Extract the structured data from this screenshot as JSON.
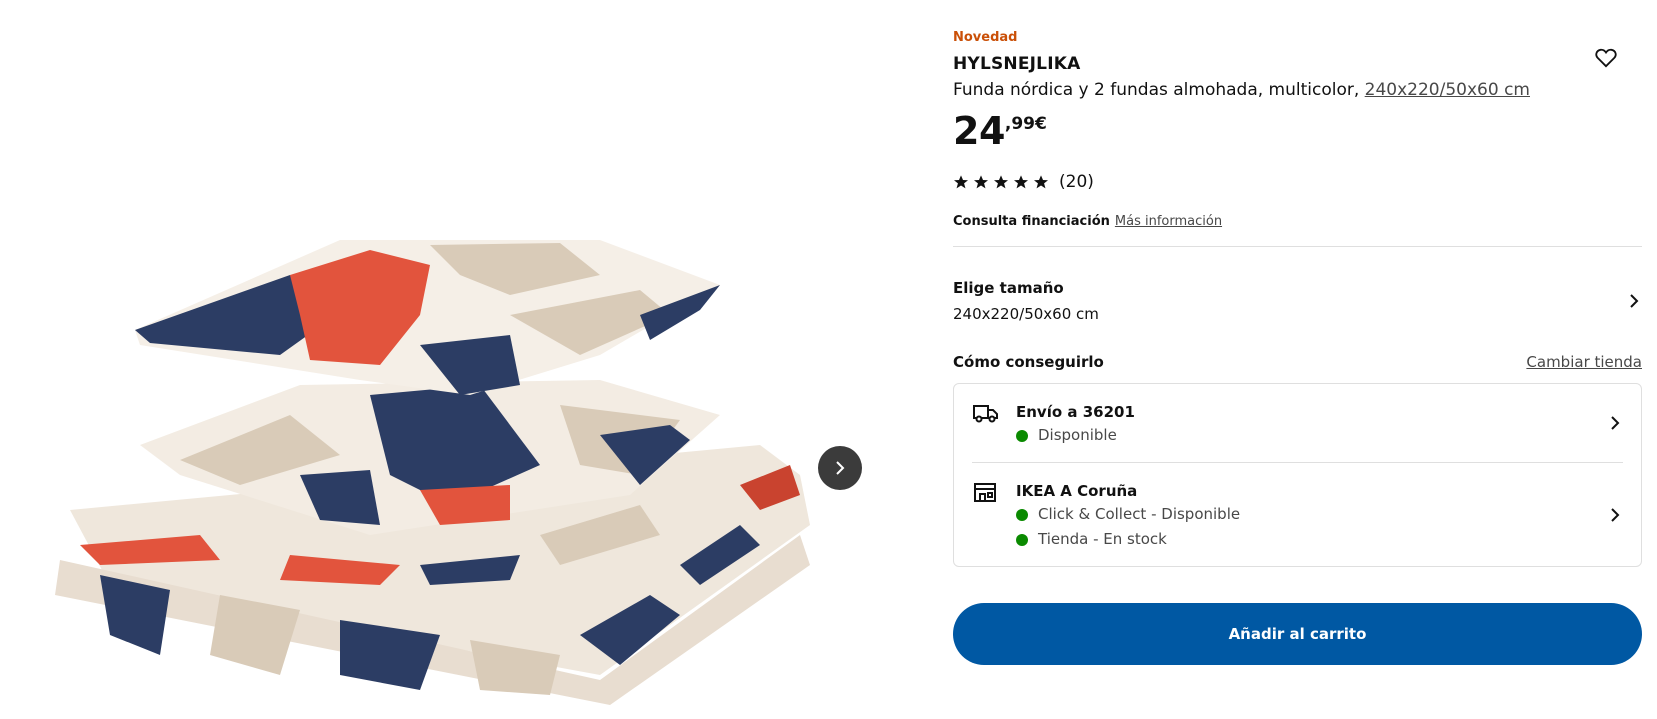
{
  "product": {
    "badge": "Novedad",
    "name": "HYLSNEJLIKA",
    "description": "Funda nórdica y 2 fundas almohada, multicolor,",
    "size_link": "240x220/50x60 cm",
    "price_integer": "24",
    "price_decimal": ",99€",
    "rating_value": 5,
    "rating_count": "(20)"
  },
  "finance": {
    "label": "Consulta financiación",
    "link": "Más información"
  },
  "size_selector": {
    "title": "Elige tamaño",
    "value": "240x220/50x60 cm"
  },
  "fulfillment": {
    "title": "Cómo conseguirlo",
    "change_store": "Cambiar tienda",
    "delivery": {
      "title": "Envío a 36201",
      "status": "Disponible"
    },
    "store": {
      "title": "IKEA A Coruña",
      "status1": "Click & Collect - Disponible",
      "status2": "Tienda - En stock"
    }
  },
  "cart_button": "Añadir al carrito",
  "colors": {
    "brand_blue": "#0058a3",
    "badge_orange": "#ca5008",
    "available_green": "#0a8a00"
  },
  "icons": [
    "heart-icon",
    "star-icon",
    "chevron-right-icon",
    "truck-icon",
    "store-icon"
  ]
}
